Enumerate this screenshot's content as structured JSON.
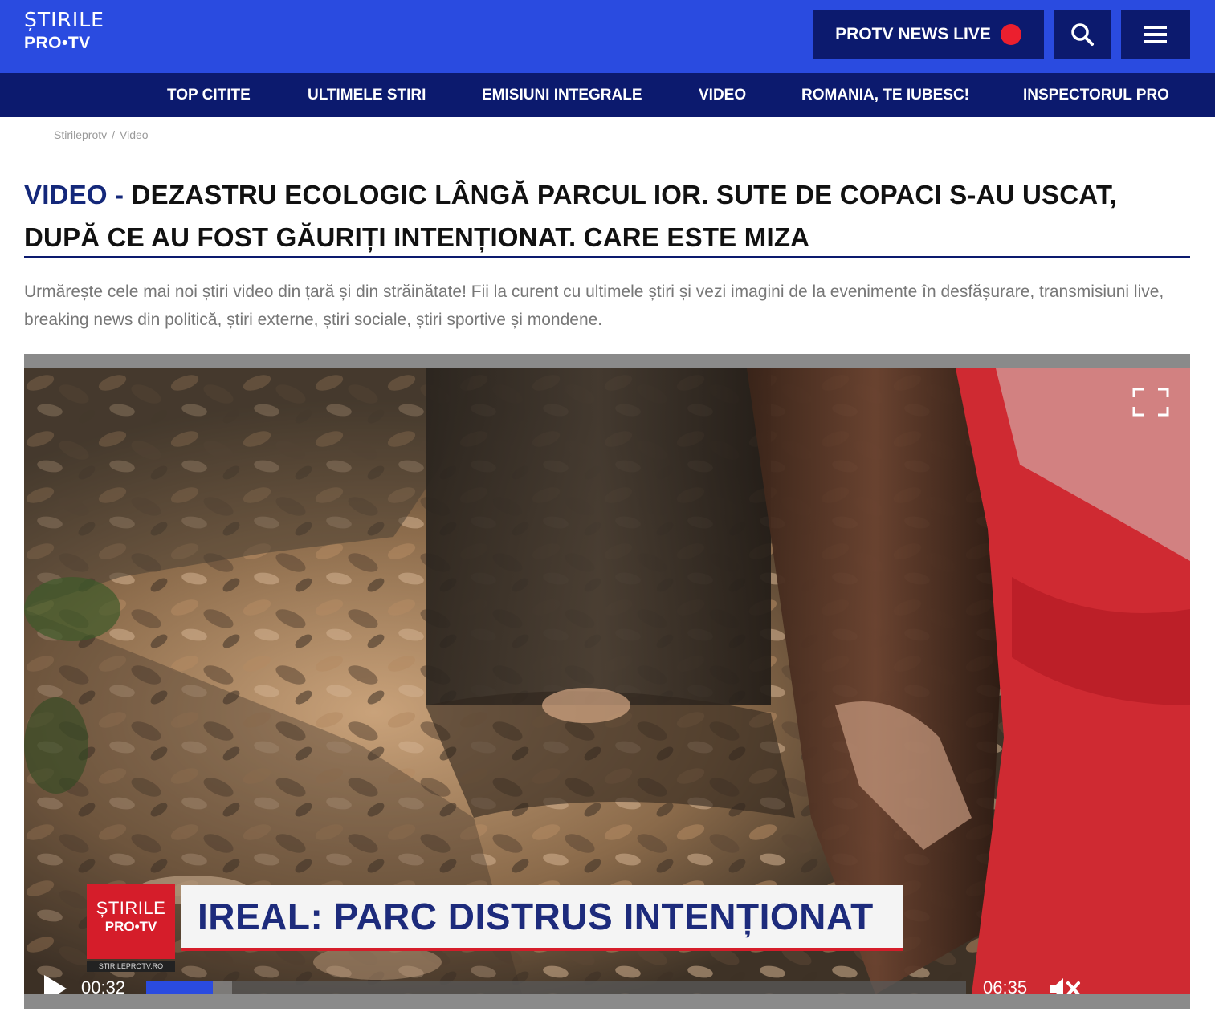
{
  "brand": {
    "line1": "ȘTIRILE",
    "line2": "PRO•TV"
  },
  "header": {
    "live_label": "PROTV NEWS LIVE",
    "live_dot_color": "#ec1f2e",
    "search_icon": "search-icon",
    "menu_icon": "hamburger-menu-icon"
  },
  "nav": {
    "items": [
      {
        "label": "TOP CITITE"
      },
      {
        "label": "ULTIMELE STIRI"
      },
      {
        "label": "EMISIUNI INTEGRALE"
      },
      {
        "label": "VIDEO"
      },
      {
        "label": "ROMANIA, TE IUBESC!"
      },
      {
        "label": "INSPECTORUL PRO"
      }
    ]
  },
  "breadcrumb": {
    "items": [
      "Stirileprotv",
      "Video"
    ],
    "separator": "/"
  },
  "article": {
    "tag": "VIDEO -",
    "title": "DEZASTRU ECOLOGIC LÂNGĂ PARCUL IOR. SUTE DE COPACI S-AU USCAT, DUPĂ CE AU FOST GĂURIȚI INTENȚIONAT. CARE ESTE MIZA",
    "description": "Urmărește cele mai noi știri video din țară și din străinătate! Fii la curent cu ultimele știri și vezi imagini de la evenimente în desfășurare, transmisiuni live, breaking news din politică, știri externe, știri sociale, știri sportive și mondene."
  },
  "video": {
    "lower_third": {
      "logo_line1": "ȘTIRILE",
      "logo_line2": "PRO•TV",
      "headline": "IREAL: PARC DISTRUS INTENȚIONAT",
      "small_text": "STIRILEPROTV.RO"
    },
    "current_time": "00:32",
    "duration": "06:35",
    "progress_fraction": 0.081,
    "buffered_fraction": 0.105,
    "icons": {
      "play": "play-icon",
      "mute": "muted-speaker-icon",
      "fullscreen": "fullscreen-icon"
    },
    "accent": "#2a4be0"
  },
  "colors": {
    "topbar": "#2a4be0",
    "navbar": "#0c1a6e",
    "tag": "#14287a",
    "red": "#d51d2a"
  }
}
